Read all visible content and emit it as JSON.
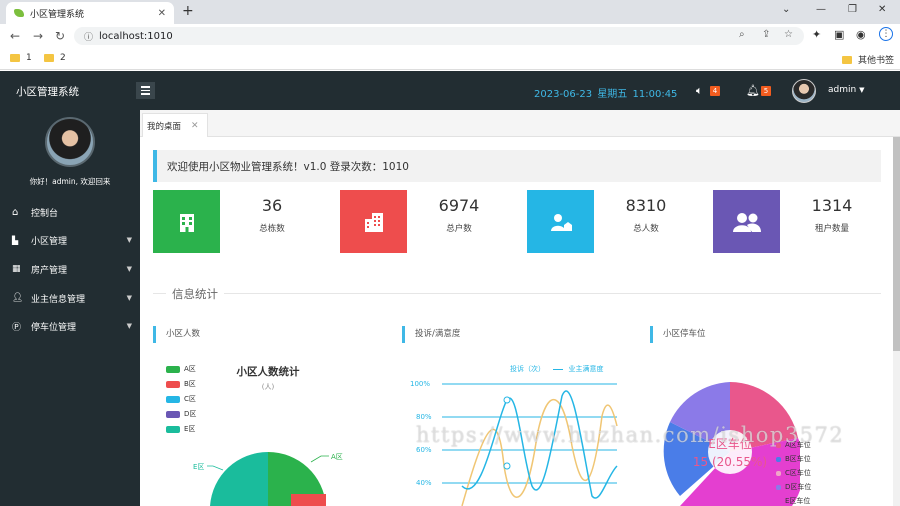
{
  "browser": {
    "tab_title": "小区管理系统",
    "new_tab": "+",
    "url": "localhost:1010",
    "bookmarks": [
      "1",
      "2"
    ],
    "other_bookmarks": "其他书签"
  },
  "header": {
    "brand": "小区管理系统",
    "date": "2023-06-23",
    "weekday": "星期五",
    "time": "11:00:45",
    "sound_badge": "4",
    "bell_badge": "5",
    "user": "admin"
  },
  "sidebar": {
    "welcome": "你好！admin, 欢迎回来",
    "items": [
      {
        "label": "控制台",
        "icon": "home-icon"
      },
      {
        "label": "小区管理",
        "icon": "community-icon"
      },
      {
        "label": "房产管理",
        "icon": "building-icon"
      },
      {
        "label": "业主信息管理",
        "icon": "person-icon"
      },
      {
        "label": "停车位管理",
        "icon": "parking-icon"
      }
    ]
  },
  "content": {
    "tab": "我的桌面",
    "notice": "欢迎使用小区物业管理系统！v1.0   登录次数：1010",
    "cards": [
      {
        "value": "36",
        "label": "总栋数",
        "color": "#2bb24c"
      },
      {
        "value": "6974",
        "label": "总户数",
        "color": "#ee4d4d"
      },
      {
        "value": "8310",
        "label": "总人数",
        "color": "#25b6e5"
      },
      {
        "value": "1314",
        "label": "租户数量",
        "color": "#6a57b4"
      }
    ],
    "section_title": "信息统计",
    "panels": {
      "people": {
        "title": "小区人数",
        "chart_title": "小区人数统计",
        "chart_subtitle": "(人)",
        "legend": [
          "A区",
          "B区",
          "C区",
          "D区",
          "E区"
        ]
      },
      "complaints": {
        "title": "投诉/满意度",
        "legend": [
          "投诉（次）",
          "业主满意度"
        ],
        "y_ticks": [
          "100%",
          "80%",
          "60%",
          "40%"
        ]
      },
      "parking": {
        "title": "小区停车位",
        "center_label": "E区车位",
        "center_value": "15 (20.55%)",
        "legend": [
          "A区车位",
          "B区车位",
          "C区车位",
          "D区车位",
          "E区车位"
        ]
      }
    },
    "watermark": "https://www.huzhan.com/ishop3572"
  },
  "chart_data": [
    {
      "type": "pie",
      "title": "小区人数统计",
      "subtitle": "(人)",
      "categories": [
        "A区",
        "B区",
        "C区",
        "D区",
        "E区"
      ],
      "colors": [
        "#2bb24c",
        "#ee4d4d",
        "#25b6e5",
        "#6a57b4",
        "#1abc9c"
      ]
    },
    {
      "type": "line",
      "series": [
        {
          "name": "投诉（次）"
        },
        {
          "name": "业主满意度"
        }
      ],
      "y_ticks": [
        "100%",
        "80%",
        "60%",
        "40%"
      ]
    },
    {
      "type": "pie",
      "categories": [
        "A区车位",
        "B区车位",
        "C区车位",
        "D区车位",
        "E区车位"
      ],
      "highlight": {
        "label": "E区车位",
        "value": 15,
        "percent": "20.55%"
      },
      "colors": [
        "#e9578c",
        "#4a7de8",
        "#f0a6c8",
        "#8b7ae8",
        "#e43fd0"
      ]
    }
  ]
}
